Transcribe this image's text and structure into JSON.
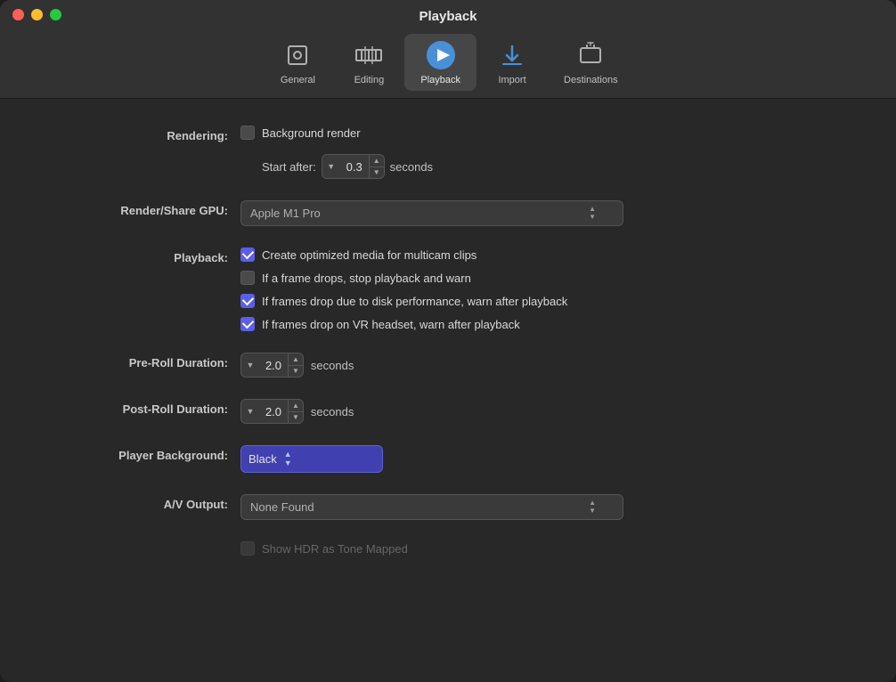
{
  "window": {
    "title": "Playback"
  },
  "toolbar": {
    "items": [
      {
        "id": "general",
        "label": "General",
        "active": false
      },
      {
        "id": "editing",
        "label": "Editing",
        "active": false
      },
      {
        "id": "playback",
        "label": "Playback",
        "active": true
      },
      {
        "id": "import",
        "label": "Import",
        "active": false
      },
      {
        "id": "destinations",
        "label": "Destinations",
        "active": false
      }
    ]
  },
  "form": {
    "rendering_label": "Rendering:",
    "background_render_label": "Background render",
    "start_after_label": "Start after:",
    "start_after_value": "0.3",
    "seconds_label": "seconds",
    "render_gpu_label": "Render/Share GPU:",
    "render_gpu_value": "Apple M1 Pro",
    "playback_label": "Playback:",
    "playback_options": [
      {
        "id": "opt1",
        "label": "Create optimized media for multicam clips",
        "checked": true
      },
      {
        "id": "opt2",
        "label": "If a frame drops, stop playback and warn",
        "checked": false
      },
      {
        "id": "opt3",
        "label": "If frames drop due to disk performance, warn after playback",
        "checked": true
      },
      {
        "id": "opt4",
        "label": "If frames drop on VR headset, warn after playback",
        "checked": true
      }
    ],
    "preroll_label": "Pre-Roll Duration:",
    "preroll_value": "2.0",
    "preroll_seconds": "seconds",
    "postroll_label": "Post-Roll Duration:",
    "postroll_value": "2.0",
    "postroll_seconds": "seconds",
    "player_bg_label": "Player Background:",
    "player_bg_value": "Black",
    "av_output_label": "A/V Output:",
    "av_output_value": "None Found",
    "hdr_label": "Show HDR as Tone Mapped"
  }
}
